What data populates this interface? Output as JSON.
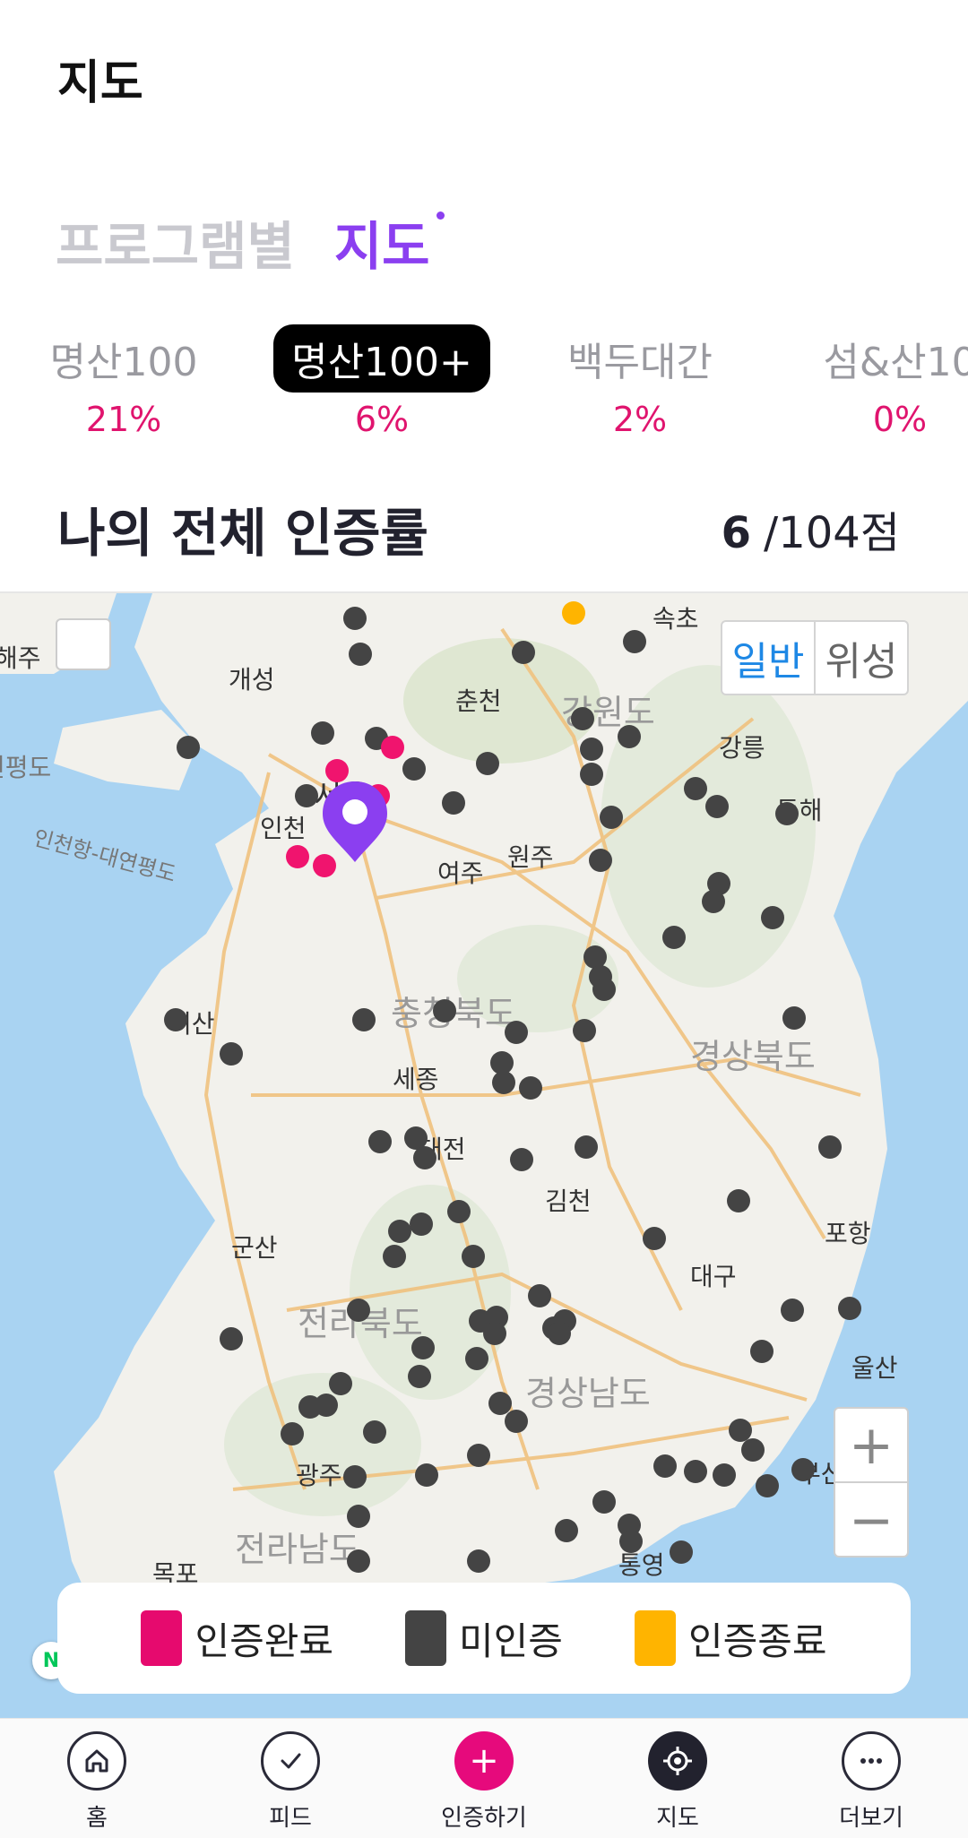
{
  "header": {
    "title": "지도"
  },
  "view_tabs": [
    {
      "label": "프로그램별",
      "active": false
    },
    {
      "label": "지도",
      "active": true
    }
  ],
  "categories": [
    {
      "label": "명산100",
      "percent": "21%",
      "active": false
    },
    {
      "label": "명산100+",
      "percent": "6%",
      "active": true
    },
    {
      "label": "백두대간",
      "percent": "2%",
      "active": false
    },
    {
      "label": "섬&산10",
      "percent": "0%",
      "active": false
    }
  ],
  "summary": {
    "title": "나의 전체 인증률",
    "count": "6",
    "total": "/104점"
  },
  "map": {
    "type_buttons": [
      "일반",
      "위성"
    ],
    "zoom_in": "+",
    "zoom_out": "−",
    "logo": "N",
    "places": [
      "속초",
      "해주",
      "개성",
      "춘천",
      "강원도",
      "강릉",
      "연평도",
      "서울",
      "인천",
      "동해",
      "인천항-대연평도",
      "여주",
      "원주",
      "서산",
      "충청북도",
      "세종",
      "경상북도",
      "대전",
      "김천",
      "포항",
      "군산",
      "대구",
      "전라북도",
      "울산",
      "경상남도",
      "광주",
      "부산",
      "전라남도",
      "목포",
      "통영"
    ]
  },
  "legend": [
    {
      "label": "인증완료",
      "color": "#e60a6e"
    },
    {
      "label": "미인증",
      "color": "#444444"
    },
    {
      "label": "인증종료",
      "color": "#ffb400"
    }
  ],
  "nav": [
    {
      "label": "홈",
      "icon": "home-icon"
    },
    {
      "label": "피드",
      "icon": "check-icon"
    },
    {
      "label": "인증하기",
      "icon": "plus-icon"
    },
    {
      "label": "지도",
      "icon": "target-icon"
    },
    {
      "label": "더보기",
      "icon": "more-icon"
    }
  ],
  "colors": {
    "accent": "#8b3ff0",
    "pink": "#e60a6e",
    "dark": "#22222e",
    "water": "#a9d3f2",
    "land": "#f2f1ec"
  }
}
